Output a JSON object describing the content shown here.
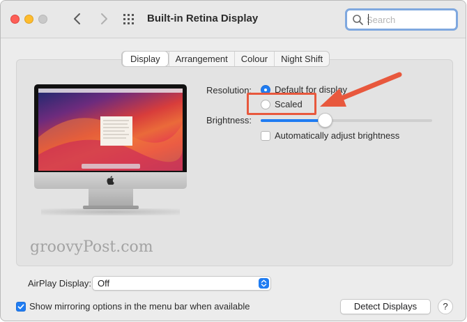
{
  "window": {
    "title": "Built-in Retina Display"
  },
  "toolbar": {
    "back_icon": "chevron-left-icon",
    "forward_icon": "chevron-right-icon",
    "show_all_icon": "grid-icon"
  },
  "search": {
    "placeholder": "Search"
  },
  "tabs": [
    {
      "label": "Display",
      "active": true
    },
    {
      "label": "Arrangement",
      "active": false
    },
    {
      "label": "Colour",
      "active": false
    },
    {
      "label": "Night Shift",
      "active": false
    }
  ],
  "settings": {
    "resolution_label": "Resolution:",
    "resolution_options": [
      {
        "label": "Default for display",
        "selected": true
      },
      {
        "label": "Scaled",
        "selected": false
      }
    ],
    "brightness_label": "Brightness:",
    "brightness_value": 0.38,
    "auto_brightness_label": "Automatically adjust brightness",
    "auto_brightness_checked": false
  },
  "watermark": "groovyPost.com",
  "airplay": {
    "label": "AirPlay Display:",
    "value": "Off"
  },
  "mirroring": {
    "label": "Show mirroring options in the menu bar when available",
    "checked": true
  },
  "buttons": {
    "detect": "Detect Displays",
    "help": "?"
  },
  "colors": {
    "accent": "#1f7cf2",
    "annotation": "#e8583d"
  }
}
